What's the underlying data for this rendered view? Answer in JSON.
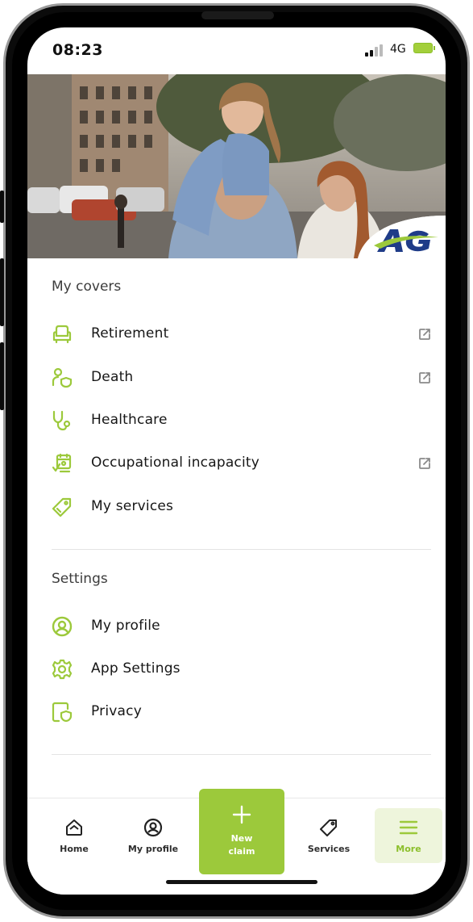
{
  "status_bar": {
    "time": "08:23",
    "network": "4G"
  },
  "brand": {
    "logo_text": "AG",
    "accent": "#9cc93b",
    "logo_blue": "#1f3c88"
  },
  "my_covers": {
    "title": "My covers",
    "items": [
      {
        "label": "Retirement",
        "icon": "armchair-icon",
        "external": true
      },
      {
        "label": "Death",
        "icon": "person-shield-icon",
        "external": true
      },
      {
        "label": "Healthcare",
        "icon": "stethoscope-icon",
        "external": false
      },
      {
        "label": "Occupational incapacity",
        "icon": "calendar-person-icon",
        "external": true
      },
      {
        "label": "My services",
        "icon": "tag-icon",
        "external": false
      }
    ]
  },
  "settings": {
    "title": "Settings",
    "items": [
      {
        "label": "My profile",
        "icon": "profile-icon"
      },
      {
        "label": "App Settings",
        "icon": "gear-icon"
      },
      {
        "label": "Privacy",
        "icon": "document-shield-icon"
      }
    ]
  },
  "tabbar": {
    "home": "Home",
    "my_profile": "My profile",
    "new_claim": "New claim",
    "services": "Services",
    "more": "More"
  }
}
